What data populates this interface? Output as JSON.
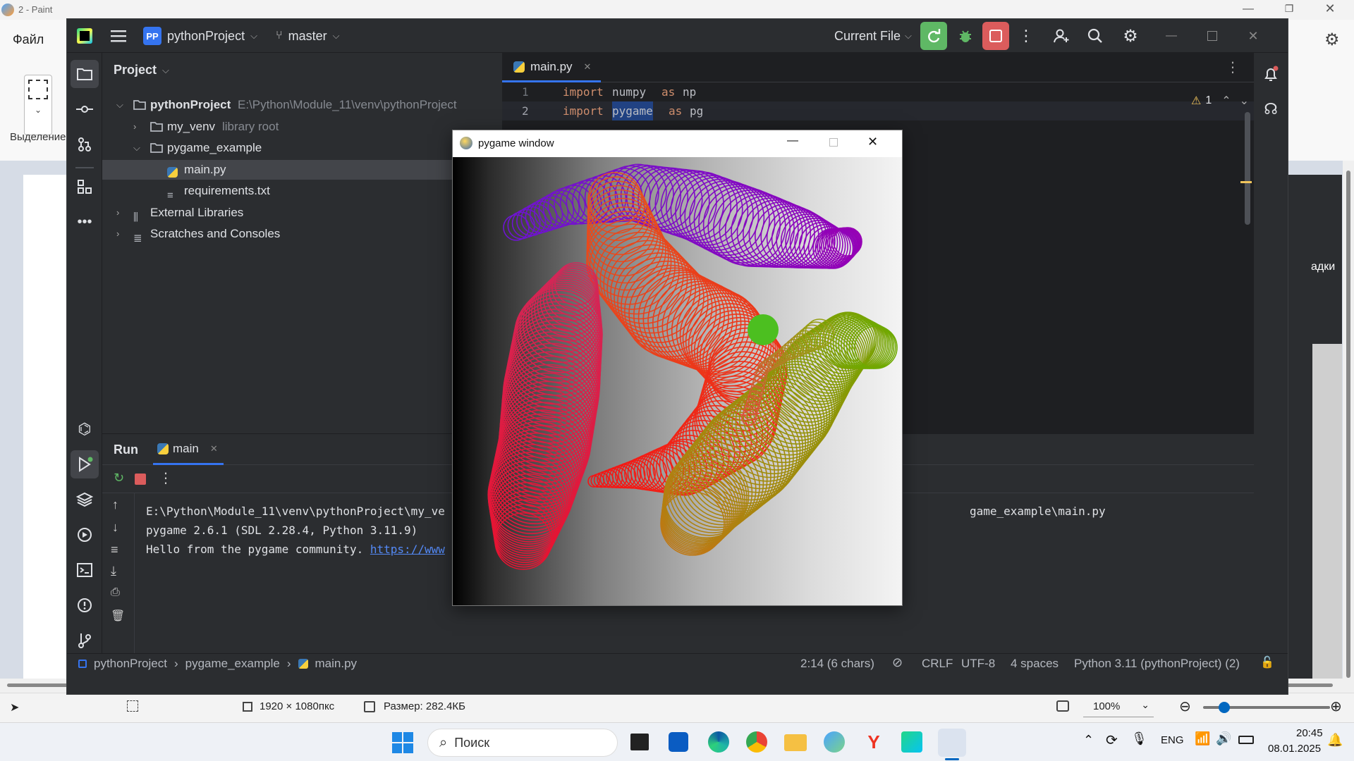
{
  "paint": {
    "title": "2 - Paint",
    "menu_file": "Файл",
    "select_label": "Выделение",
    "right_settings_label": "адки",
    "status": {
      "dimensions": "1920 × 1080пкс",
      "size": "Размер: 282.4КБ",
      "zoom": "100%"
    }
  },
  "ide": {
    "project_badge": "PP",
    "project_name": "pythonProject",
    "branch": "master",
    "run_config": "Current File",
    "project_tool_title": "Project",
    "tree": [
      {
        "label": "pythonProject",
        "hint": "E:\\Python\\Module_11\\venv\\pythonProject",
        "level": 0,
        "expanded": true,
        "type": "folder"
      },
      {
        "label": "my_venv",
        "hint": "library root",
        "level": 1,
        "expanded": false,
        "type": "folder"
      },
      {
        "label": "pygame_example",
        "hint": "",
        "level": 1,
        "expanded": true,
        "type": "folder"
      },
      {
        "label": "main.py",
        "hint": "",
        "level": 2,
        "type": "python",
        "selected": true
      },
      {
        "label": "requirements.txt",
        "hint": "",
        "level": 2,
        "type": "text"
      },
      {
        "label": "External Libraries",
        "hint": "",
        "level": 0,
        "expanded": false,
        "type": "lib"
      },
      {
        "label": "Scratches and Consoles",
        "hint": "",
        "level": 0,
        "expanded": false,
        "type": "scratch"
      }
    ],
    "editor": {
      "tab": "main.py",
      "lines": [
        {
          "num": "1",
          "kw": "import",
          "mod": "numpy",
          "as": "as",
          "alias": "np"
        },
        {
          "num": "2",
          "kw": "import",
          "mod": "pygame",
          "as": "as",
          "alias": "pg"
        }
      ],
      "warnings": "1"
    },
    "run": {
      "title": "Run",
      "tab": "main",
      "output": [
        "E:\\Python\\Module_11\\venv\\pythonProject\\my_ve",
        "pygame 2.6.1 (SDL 2.28.4, Python 3.11.9)",
        "Hello from the pygame community. "
      ],
      "output_line1_tail": "game_example\\main.py",
      "link": "https://www"
    },
    "status": {
      "crumbs": [
        "pythonProject",
        "pygame_example",
        "main.py"
      ],
      "position": "2:14 (6 chars)",
      "line_sep": "CRLF",
      "encoding": "UTF-8",
      "indent": "4 spaces",
      "interpreter": "Python 3.11 (pythonProject) (2)"
    }
  },
  "pygame": {
    "title": "pygame window"
  },
  "taskbar": {
    "search_placeholder": "Поиск",
    "lang": "ENG",
    "time": "20:45",
    "date": "08.01.2025"
  },
  "colors": {
    "ide_bg": "#1e1f22",
    "ide_panel": "#2b2d30",
    "accent_blue": "#3574f0",
    "run_green": "#5fb865",
    "stop_red": "#db5c5c",
    "keyword": "#cf8e6d"
  }
}
